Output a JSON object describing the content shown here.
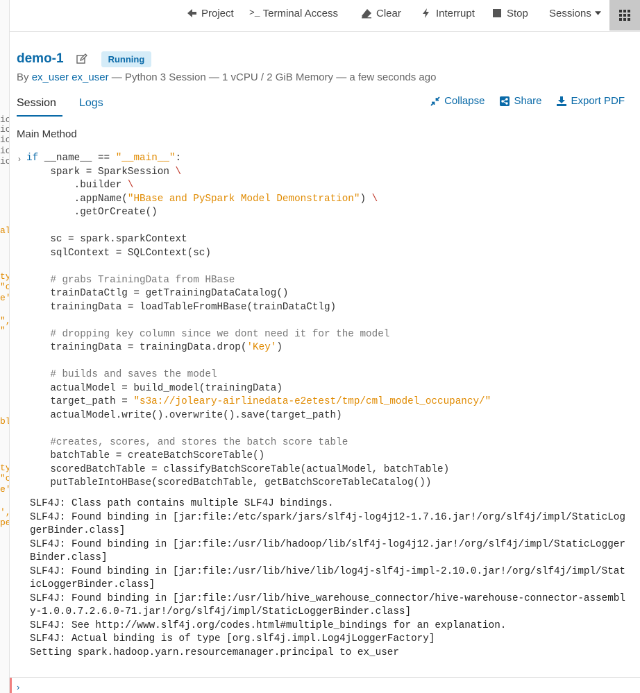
{
  "toolbar": {
    "project_label": "Project",
    "terminal_label": "Terminal Access",
    "clear_label": "Clear",
    "interrupt_label": "Interrupt",
    "stop_label": "Stop",
    "sessions_label": "Sessions"
  },
  "session": {
    "title": "demo-1",
    "status": "Running",
    "by_prefix": "By",
    "user": "ex_user ex_user",
    "details": "— Python 3 Session — 1 vCPU / 2 GiB Memory — a few seconds ago"
  },
  "tabs": {
    "session": "Session",
    "logs": "Logs"
  },
  "actions": {
    "collapse": "Collapse",
    "share": "Share",
    "export": "Export PDF"
  },
  "section": {
    "heading": "Main Method"
  },
  "code": {
    "line1": {
      "kw": "if",
      "a": " __name__ == ",
      "str": "\"__main__\"",
      "b": ":"
    },
    "line2": {
      "a": "    spark = SparkSession ",
      "bs": "\\"
    },
    "line3": {
      "a": "        .builder ",
      "bs": "\\"
    },
    "line4": {
      "a": "        .appName(",
      "str": "\"HBase and PySpark Model Demonstration\"",
      "b": ") ",
      "bs": "\\"
    },
    "line5": "        .getOrCreate()",
    "line7": "    sc = spark.sparkContext",
    "line8": "    sqlContext = SQLContext(sc)",
    "line10": "    # grabs TrainingData from HBase",
    "line11": "    trainDataCtlg = getTrainingDataCatalog()",
    "line12": "    trainingData = loadTableFromHBase(trainDataCtlg)",
    "line14": "    # dropping key column since we dont need it for the model",
    "line15": {
      "a": "    trainingData = trainingData.drop(",
      "str": "'Key'",
      "b": ")"
    },
    "line17": "    # builds and saves the model",
    "line18": "    actualModel = build_model(trainingData)",
    "line19": {
      "a": "    target_path = ",
      "str": "\"s3a://joleary-airlinedata-e2etest/tmp/cml_model_occupancy/\""
    },
    "line20": "    actualModel.write().overwrite().save(target_path)",
    "line22": "    #creates, scores, and stores the batch score table",
    "line23": "    batchTable = createBatchScoreTable()",
    "line24": "    scoredBatchTable = classifyBatchScoreTable(actualModel, batchTable)",
    "line25": "    putTableIntoHBase(scoredBatchTable, getBatchScoreTableCatalog())"
  },
  "output": [
    "SLF4J: Class path contains multiple SLF4J bindings.",
    "SLF4J: Found binding in [jar:file:/etc/spark/jars/slf4j-log4j12-1.7.16.jar!/org/slf4j/impl/StaticLog",
    "gerBinder.class]",
    "SLF4J: Found binding in [jar:file:/usr/lib/hadoop/lib/slf4j-log4j12.jar!/org/slf4j/impl/StaticLogger",
    "Binder.class]",
    "SLF4J: Found binding in [jar:file:/usr/lib/hive/lib/log4j-slf4j-impl-2.10.0.jar!/org/slf4j/impl/Stat",
    "icLoggerBinder.class]",
    "SLF4J: Found binding in [jar:file:/usr/lib/hive_warehouse_connector/hive-warehouse-connector-assembl",
    "y-1.0.0.7.2.6.0-71.jar!/org/slf4j/impl/StaticLoggerBinder.class]",
    "SLF4J: See http://www.slf4j.org/codes.html#multiple_bindings for an explanation.",
    "SLF4J: Actual binding is of type [org.slf4j.impl.Log4jLoggerFactory]",
    "Setting spark.hadoop.yarn.resourcemanager.principal to ex_user"
  ],
  "leftstrip": {
    "frag1": "ic",
    "frag2": "ic",
    "frag3": "ic",
    "frag4": "ic",
    "frag5": "ic",
    "frag6": "al",
    "frag7": "ty",
    "frag8": "\"c",
    "frag9": "e'",
    "frag10": "\",",
    "frag11": "\"",
    "frag12": "bl",
    "frag13": "ty",
    "frag14": "\"c",
    "frag15": "e'",
    "frag16": "',",
    "frag17": "pe"
  },
  "colors": {
    "accent": "#0a6aa8",
    "string": "#e08a00",
    "badge_bg": "#d5ecf8"
  }
}
